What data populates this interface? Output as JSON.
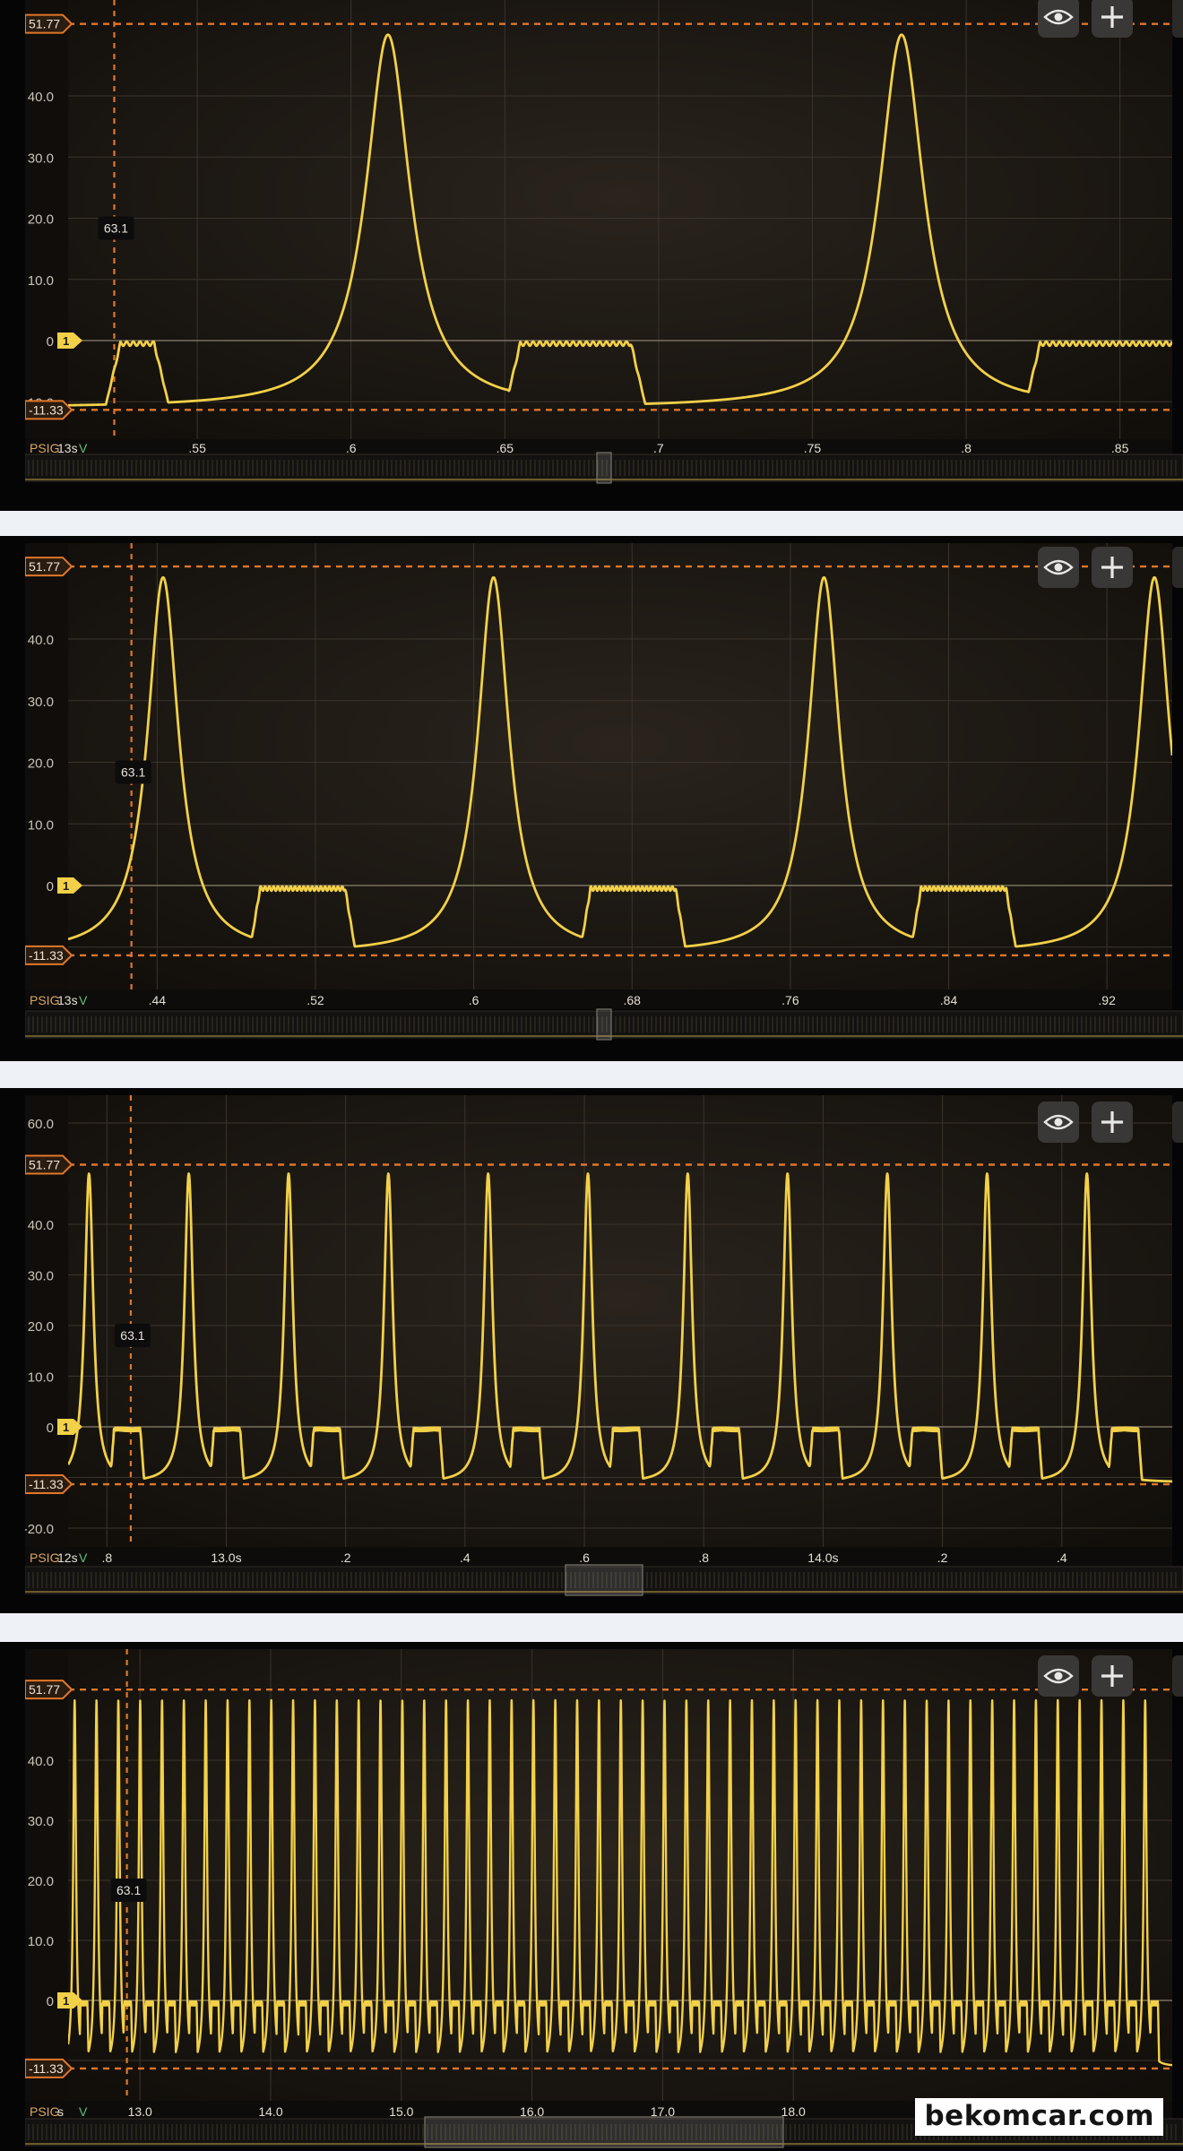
{
  "app": {
    "watermark": "bekomcar.com",
    "icons": [
      "eye-icon",
      "plus-icon"
    ],
    "colors": {
      "trace": "#f2d048",
      "cursor": "#e1772a",
      "background": "#050505",
      "plot": "#1c1712",
      "gap": "#eef1f5"
    }
  },
  "chart_data": [
    {
      "type": "line",
      "channel_label": "PSIG",
      "time_label": "13s",
      "unit_label": "V",
      "ylim": [
        -13,
        50
      ],
      "yticks": [
        40,
        30,
        20,
        10,
        0,
        -10
      ],
      "ytick_labels": [
        "40.0",
        "30.0",
        "20.0",
        "10.0",
        "0",
        "-10.0"
      ],
      "xlim": [
        0.508,
        0.867
      ],
      "xticks": [
        0.55,
        0.6,
        0.65,
        0.7,
        0.75,
        0.8,
        0.85
      ],
      "xtick_labels": [
        ".55",
        ".6",
        ".65",
        ".7",
        ".75",
        ".8",
        ".85"
      ],
      "upper_cursor_value": 51.77,
      "upper_cursor_label": "51.77",
      "lower_cursor_value": -11.33,
      "lower_cursor_label": "-11.33",
      "zero_marker_label": "1",
      "vertical_cursor_x": 0.523,
      "cursor_readout": "63.1",
      "readout_y": 20,
      "pattern": {
        "peaks": [
          0.612,
          0.779
        ],
        "peak_value": 50,
        "peak_halfwidth": 0.011,
        "plateaus": [
          [
            0.525,
            0.536
          ],
          [
            0.655,
            0.691
          ],
          [
            0.824,
            0.87
          ]
        ],
        "plateau_value": -0.5,
        "rest_value": -11
      },
      "grid": true,
      "scrollbar_thumb": 0.5
    },
    {
      "type": "line",
      "channel_label": "PSIG",
      "time_label": "13s",
      "unit_label": "V",
      "ylim": [
        -13,
        50
      ],
      "yticks": [
        40,
        30,
        20,
        10,
        0,
        -10
      ],
      "ytick_labels": [
        "40.0",
        "30.0",
        "20.0",
        "10.0",
        "0",
        ""
      ],
      "xlim": [
        0.395,
        0.953
      ],
      "xticks": [
        0.44,
        0.52,
        0.6,
        0.68,
        0.76,
        0.84,
        0.92
      ],
      "xtick_labels": [
        ".44",
        ".52",
        ".6",
        ".68",
        ".76",
        ".84",
        ".92"
      ],
      "upper_cursor_value": 51.77,
      "upper_cursor_label": "51.77",
      "lower_cursor_value": -11.33,
      "lower_cursor_label": "-11.33",
      "zero_marker_label": "1",
      "vertical_cursor_x": 0.427,
      "cursor_readout": "63.1",
      "readout_y": 20,
      "pattern": {
        "peaks": [
          0.443,
          0.61,
          0.777,
          0.944
        ],
        "peak_value": 50,
        "peak_halfwidth": 0.012,
        "plateaus": [
          [
            0.492,
            0.535
          ],
          [
            0.659,
            0.702
          ],
          [
            0.826,
            0.869
          ]
        ],
        "plateau_value": -0.5,
        "rest_value": -11
      },
      "grid": true,
      "scrollbar_thumb": 0.5
    },
    {
      "type": "line",
      "channel_label": "PSIG",
      "time_label": "12s",
      "unit_label": "V",
      "ylim": [
        -24,
        65
      ],
      "yticks": [
        60,
        40,
        30,
        20,
        10,
        0,
        -10,
        -20
      ],
      "ytick_labels": [
        "60.0",
        "40.0",
        "30.0",
        "20.0",
        "10.0",
        "0",
        "",
        "-20.0"
      ],
      "xlim": [
        12.735,
        14.585
      ],
      "xticks": [
        12.8,
        13.0,
        13.2,
        13.4,
        13.6,
        13.8,
        14.0,
        14.2,
        14.4
      ],
      "xtick_labels": [
        ".8",
        "13.0s",
        ".2",
        ".4",
        ".6",
        ".8",
        "14.0s",
        ".2",
        ".4"
      ],
      "upper_cursor_value": 51.77,
      "upper_cursor_label": "51.77",
      "lower_cursor_value": -11.33,
      "lower_cursor_label": "-11.33",
      "zero_marker_label": "1",
      "vertical_cursor_x": 12.84,
      "cursor_readout": "63.1",
      "readout_y": 20,
      "pattern": {
        "first_peak": 12.77,
        "period": 0.1672,
        "count": 11,
        "peak_value": 50,
        "peak_halfwidth": 0.011,
        "plateau_offset": [
          0.042,
          0.086
        ],
        "plateau_value": -0.5,
        "rest_value": -11
      },
      "grid": true,
      "scrollbar_thumb": 0.5
    },
    {
      "type": "line",
      "channel_label": "PSIG",
      "time_label": "s",
      "unit_label": "V",
      "ylim": [
        -24,
        55
      ],
      "yticks": [
        40,
        30,
        20,
        10,
        0,
        -10,
        -20
      ],
      "ytick_labels": [
        "40.0",
        "30.0",
        "20.0",
        "10.0",
        "0",
        "",
        "-20.0"
      ],
      "xlim": [
        12.45,
        20.9
      ],
      "xticks": [
        13,
        14,
        15,
        16,
        17,
        18
      ],
      "xtick_labels": [
        "13.0",
        "14.0",
        "15.0",
        "16.0",
        "17.0",
        "18.0"
      ],
      "upper_cursor_value": 51.77,
      "upper_cursor_label": "51.77",
      "lower_cursor_value": -11.33,
      "lower_cursor_label": "-11.33",
      "zero_marker_label": "1",
      "vertical_cursor_x": 12.9,
      "cursor_readout": "63.1",
      "readout_y": 20,
      "pattern": {
        "first_peak": 12.5,
        "period": 0.1672,
        "count": 50,
        "peak_value": 50,
        "peak_halfwidth": 0.016,
        "plateau_offset": [
          0.045,
          0.098
        ],
        "plateau_value": -0.5,
        "rest_value": -11
      },
      "grid": true,
      "scrollbar_thumb": 0.5
    }
  ]
}
